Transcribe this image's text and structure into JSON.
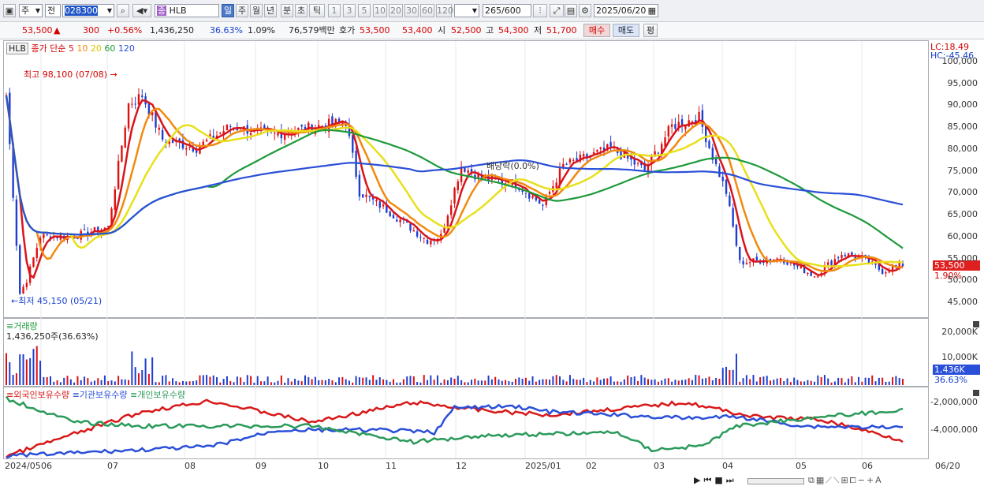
{
  "toolbar": {
    "period_type": "주",
    "market": "전",
    "code": "028300",
    "stock_name": "HLB",
    "periods": [
      "일",
      "주",
      "월",
      "년",
      "분",
      "초",
      "틱"
    ],
    "intervals": [
      "1",
      "3",
      "5",
      "10",
      "20",
      "30",
      "60",
      "120"
    ],
    "count": "265",
    "count_total": "/600",
    "date": "2025/06/20"
  },
  "quote": {
    "price": "53,500",
    "change": "300",
    "change_pct": "+0.56%",
    "volume": "1,436,250",
    "volume_ratio": "36.63%",
    "turnover_pct": "1.09%",
    "trade_value": "76,579백만",
    "bid_label": "호가",
    "ask": "53,500",
    "bid": "53,400",
    "open_label": "시",
    "open": "52,500",
    "high_label": "고",
    "high": "54,300",
    "low_label": "저",
    "low": "51,700",
    "buy_label": "매수",
    "sell_label": "매도",
    "eval_label": "평"
  },
  "price_panel": {
    "legend_name": "HLB",
    "legend_ma_title": "종가 단순",
    "ma_periods": [
      "5",
      "10",
      "20",
      "60",
      "120"
    ],
    "ma_colors": [
      "#d8141c",
      "#f08a10",
      "#e8e01a",
      "#1c9a3a",
      "#2a4fd8"
    ],
    "high_marker": "최고 98,100 (07/08)",
    "low_marker": "최저 45,150 (05/21)",
    "dividend_marker": "배당락(0.0%)",
    "lc": "LC:18.49",
    "hc": "HC:-45.46",
    "last_price_tag": "53,500",
    "last_pct_tag": "1.90%",
    "y_ticks": [
      "100,000",
      "95,000",
      "90,000",
      "85,000",
      "80,000",
      "75,000",
      "70,000",
      "65,000",
      "60,000",
      "55,000",
      "50,000",
      "45,000"
    ]
  },
  "volume_panel": {
    "title": "거래량",
    "info": "1,436,250주(36.63%)",
    "y_ticks": [
      "20,000K",
      "10,000K"
    ],
    "last_tag": "1,436K",
    "last_pct": "36.63%"
  },
  "holding_panel": {
    "legend": [
      "외국인보유수량",
      "기관보유수량",
      "개인보유수량"
    ],
    "legend_colors": [
      "#d81818",
      "#2a4fd8",
      "#2a9a5a"
    ],
    "y_ticks": [
      "-2,000,000",
      "-4,000,000"
    ]
  },
  "x_axis": {
    "labels": [
      "2024/05",
      "06",
      "07",
      "08",
      "09",
      "10",
      "11",
      "12",
      "2025/01",
      "02",
      "03",
      "04",
      "05",
      "06"
    ],
    "right_label": "06/20"
  },
  "chart_data": {
    "type": "candlestick",
    "y_range": [
      43000,
      100000
    ],
    "last_close": 53500,
    "volume_unit": "K"
  }
}
